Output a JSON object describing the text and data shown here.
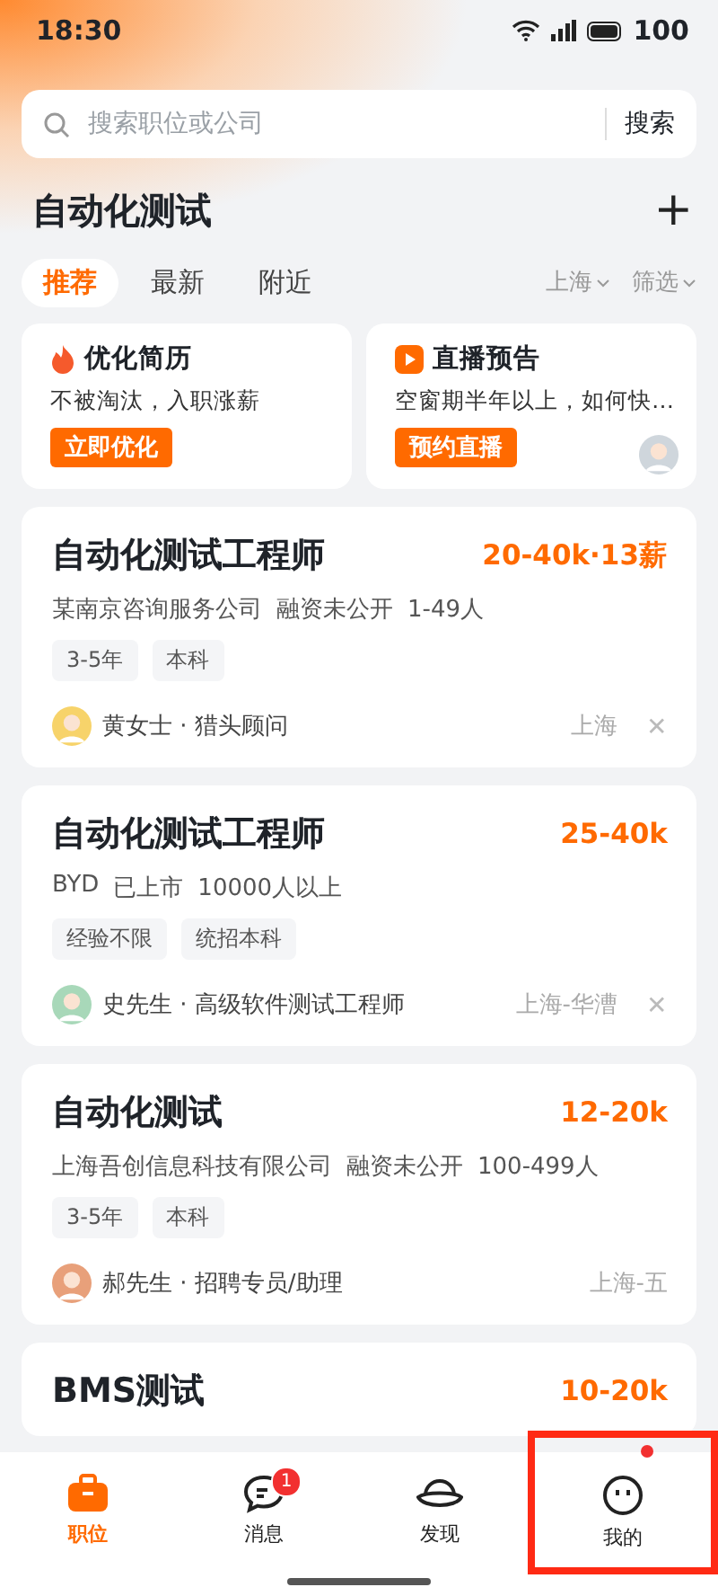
{
  "status_bar": {
    "time": "18:30",
    "battery": "100"
  },
  "search": {
    "placeholder": "搜索职位或公司",
    "button": "搜索"
  },
  "heading": {
    "title": "自动化测试",
    "add": "+"
  },
  "tabs": [
    {
      "label": "推荐",
      "selected": true
    },
    {
      "label": "最新",
      "selected": false
    },
    {
      "label": "附近",
      "selected": false
    }
  ],
  "filters": [
    "上海",
    "筛选"
  ],
  "promos": [
    {
      "kind": "resume",
      "title": "优化简历",
      "text": "不被淘汰，入职涨薪",
      "button": "立即优化"
    },
    {
      "kind": "live",
      "title": "直播预告",
      "text": "空窗期半年以上，如何快…",
      "button": "预约直播"
    }
  ],
  "jobs": [
    {
      "title": "自动化测试工程师",
      "salary": "20-40k·13薪",
      "company": [
        "某南京咨询服务公司",
        "融资未公开",
        "1-49人"
      ],
      "tags": [
        "3-5年",
        "本科"
      ],
      "recruiter": "黄女士 · 猎头顾问",
      "color": "#f7d36a",
      "location": "上海",
      "close": "✕"
    },
    {
      "title": "自动化测试工程师",
      "salary": "25-40k",
      "company": [
        "BYD",
        "已上市",
        "10000人以上"
      ],
      "tags": [
        "经验不限",
        "统招本科"
      ],
      "recruiter": "史先生 · 高级软件测试工程师",
      "color": "#a8d8b9",
      "location": "上海-华漕",
      "close": "✕"
    },
    {
      "title": "自动化测试",
      "salary": "12-20k",
      "company": [
        "上海吾创信息科技有限公司",
        "融资未公开",
        "100-499人"
      ],
      "tags": [
        "3-5年",
        "本科"
      ],
      "recruiter": "郝先生 · 招聘专员/助理",
      "color": "#e8a07a",
      "location": "上海-五"
    },
    {
      "title": "BMS测试",
      "salary": "10-20k"
    }
  ],
  "nav": [
    {
      "kind": "jobs",
      "label": "职位",
      "selected": true,
      "dot": false,
      "highlighted": false
    },
    {
      "kind": "messages",
      "label": "消息",
      "selected": false,
      "badge": "1",
      "dot": false,
      "highlighted": false
    },
    {
      "kind": "discover",
      "label": "发现",
      "selected": false,
      "dot": false,
      "highlighted": false
    },
    {
      "kind": "me",
      "label": "我的",
      "selected": false,
      "dot": true,
      "highlighted": true
    }
  ]
}
